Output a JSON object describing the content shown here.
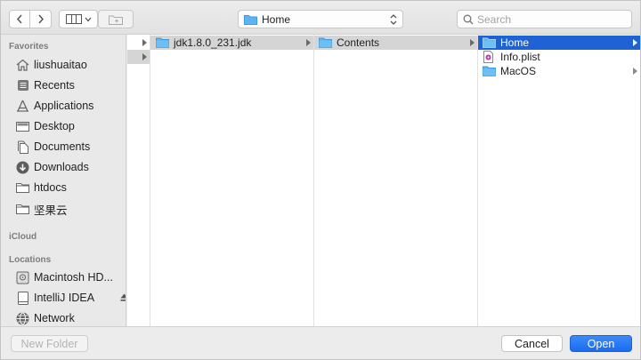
{
  "toolbar": {
    "path_label": "Home",
    "search_placeholder": "Search"
  },
  "sidebar": {
    "favorites_heading": "Favorites",
    "favorites": [
      {
        "label": "liushuaitao",
        "icon": "home-icon"
      },
      {
        "label": "Recents",
        "icon": "recents-icon"
      },
      {
        "label": "Applications",
        "icon": "applications-icon"
      },
      {
        "label": "Desktop",
        "icon": "desktop-icon"
      },
      {
        "label": "Documents",
        "icon": "documents-icon"
      },
      {
        "label": "Downloads",
        "icon": "downloads-icon"
      },
      {
        "label": "htdocs",
        "icon": "folder-icon"
      },
      {
        "label": "坚果云",
        "icon": "folder-icon"
      }
    ],
    "icloud_heading": "iCloud",
    "locations_heading": "Locations",
    "locations": [
      {
        "label": "Macintosh HD...",
        "icon": "hard-drive-icon"
      },
      {
        "label": "IntelliJ IDEA",
        "icon": "disk-image-icon",
        "ejectable": true
      },
      {
        "label": "Network",
        "icon": "network-icon"
      }
    ]
  },
  "browser": {
    "col1": [
      "jdk1.8.0_231.jdk",
      ""
    ],
    "col2": [
      "Contents"
    ],
    "col3": [
      {
        "label": "Home",
        "icon": "folder-icon",
        "selected": true,
        "has_children": true
      },
      {
        "label": "Info.plist",
        "icon": "plist-file-icon",
        "selected": false,
        "has_children": false
      },
      {
        "label": "MacOS",
        "icon": "folder-icon",
        "selected": false,
        "has_children": true
      }
    ]
  },
  "footer": {
    "new_folder_label": "New Folder",
    "cancel_label": "Cancel",
    "open_label": "Open"
  },
  "colors": {
    "selection_blue": "#1e62d6",
    "folder_blue": "#5eb4f0",
    "primary_button": "#1a6bf0"
  }
}
